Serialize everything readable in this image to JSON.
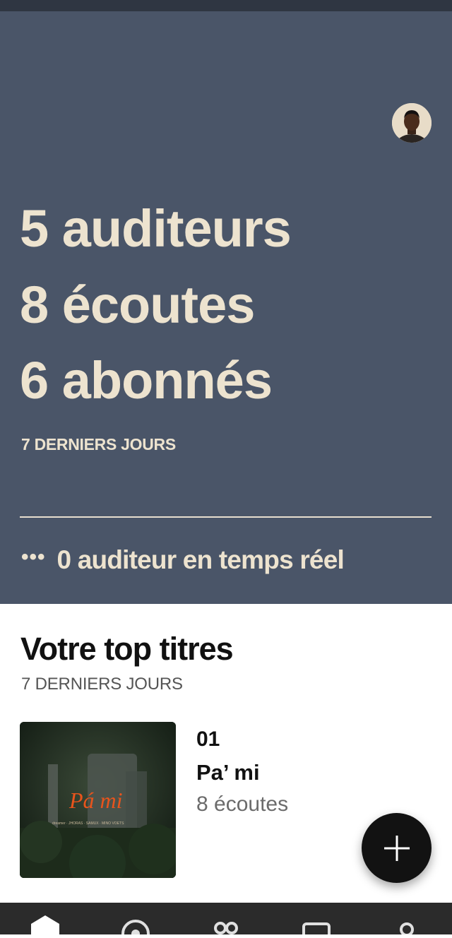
{
  "stats": {
    "listeners": "5 auditeurs",
    "streams": "8 écoutes",
    "followers": "6 abonnés",
    "period": "7 DERNIERS JOURS",
    "realtime_dots": "•••",
    "realtime": "0 auditeur en temps réel"
  },
  "top_tracks": {
    "title": "Votre top titres",
    "period": "7 DERNIERS JOURS",
    "items": [
      {
        "rank": "01",
        "title": "Pa’ mi",
        "plays": "8 écoutes",
        "cover_text": "Pá mi",
        "cover_credits": "dreamer · JHORAS · SAMUX · MINO VOETS"
      }
    ]
  },
  "fab": {
    "icon": "plus-icon"
  },
  "nav": {
    "items": [
      {
        "icon": "home-icon"
      },
      {
        "icon": "search-icon"
      },
      {
        "icon": "audience-icon"
      },
      {
        "icon": "music-icon"
      },
      {
        "icon": "profile-icon"
      }
    ]
  },
  "colors": {
    "hero_bg": "#4a5568",
    "hero_text": "#ede3cf",
    "fab_bg": "#121212",
    "nav_bg": "#2b2b2b",
    "cover_accent": "#e8541c"
  }
}
